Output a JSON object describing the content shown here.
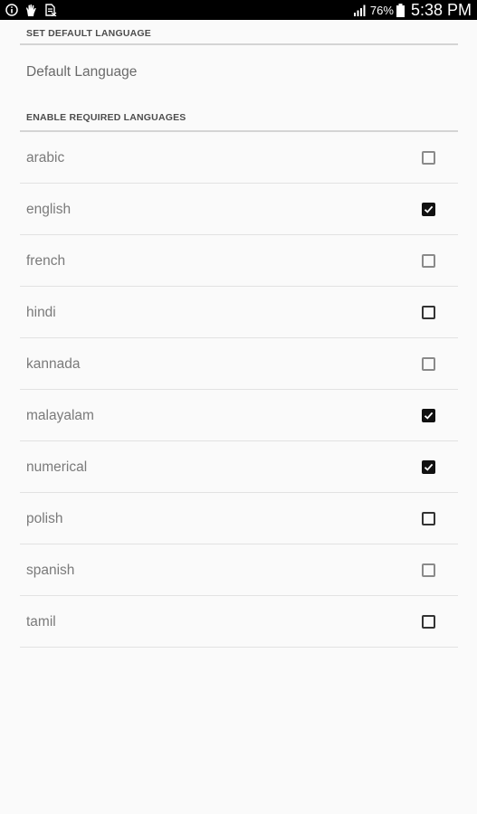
{
  "status_bar": {
    "icons": [
      "info-icon",
      "hand-icon",
      "document-icon",
      "signal-icon",
      "battery-icon"
    ],
    "battery": "76%",
    "time": "5:38 PM"
  },
  "default_section": {
    "header": "SET DEFAULT LANGUAGE",
    "item": "Default Language"
  },
  "languages_section": {
    "header": "ENABLE REQUIRED LANGUAGES",
    "items": [
      {
        "label": "arabic",
        "checked": false
      },
      {
        "label": "english",
        "checked": true
      },
      {
        "label": "french",
        "checked": false
      },
      {
        "label": "hindi",
        "checked": false
      },
      {
        "label": "kannada",
        "checked": false
      },
      {
        "label": "malayalam",
        "checked": true
      },
      {
        "label": "numerical",
        "checked": true
      },
      {
        "label": "polish",
        "checked": false
      },
      {
        "label": "spanish",
        "checked": false
      },
      {
        "label": "tamil",
        "checked": false
      }
    ]
  }
}
